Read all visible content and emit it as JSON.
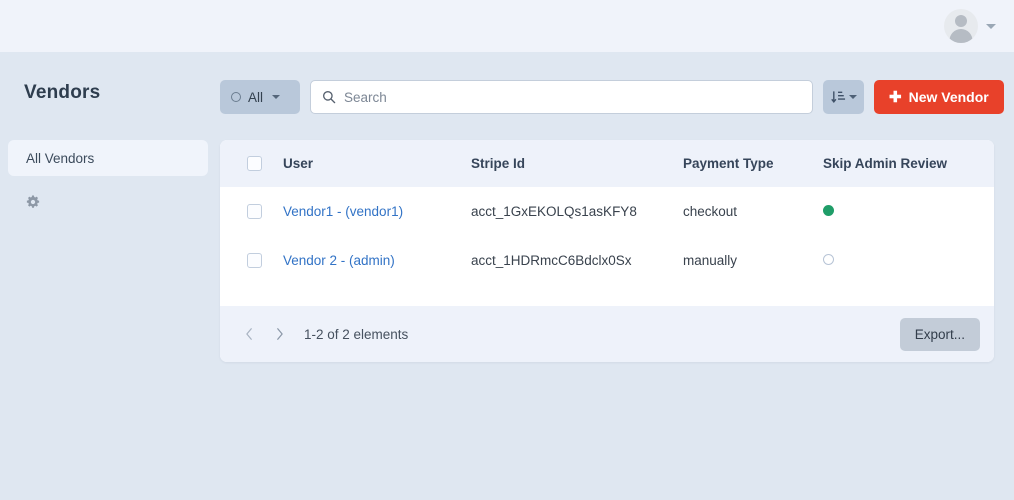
{
  "topbar": {
    "avatar_icon": "user-avatar-icon",
    "caret_icon": "chevron-down-icon"
  },
  "header": {
    "title": "Vendors"
  },
  "toolbar": {
    "filter": {
      "label": "All",
      "icon": "circle-outline-icon",
      "caret": "chevron-down-icon"
    },
    "search": {
      "placeholder": "Search",
      "value": "",
      "icon": "search-icon"
    },
    "sort": {
      "icon": "sort-descending-icon",
      "caret": "chevron-down-icon"
    },
    "new_vendor": {
      "label": "New Vendor",
      "icon": "plus-icon",
      "color": "#e8412a"
    }
  },
  "sidebar": {
    "items": [
      {
        "label": "All Vendors",
        "active": true
      }
    ],
    "settings_icon": "gear-icon"
  },
  "table": {
    "columns": [
      "User",
      "Stripe Id",
      "Payment Type",
      "Skip Admin Review"
    ],
    "rows": [
      {
        "user": "Vendor1 - (vendor1)",
        "stripe_id": "acct_1GxEKOLQs1asKFY8",
        "payment_type": "checkout",
        "skip_admin_review": true
      },
      {
        "user": "Vendor 2 - (admin)",
        "stripe_id": "acct_1HDRmcC6Bdclx0Sx",
        "payment_type": "manually",
        "skip_admin_review": false
      }
    ]
  },
  "footer": {
    "prev_icon": "chevron-left-icon",
    "next_icon": "chevron-right-icon",
    "pagination": "1-2 of 2 elements",
    "export_label": "Export..."
  },
  "colors": {
    "page_background": "#dfe7f1",
    "topbar": "#f0f3fa",
    "accent_red": "#e8412a",
    "link_blue": "#3273c6",
    "status_on_green": "#1f9d68"
  }
}
